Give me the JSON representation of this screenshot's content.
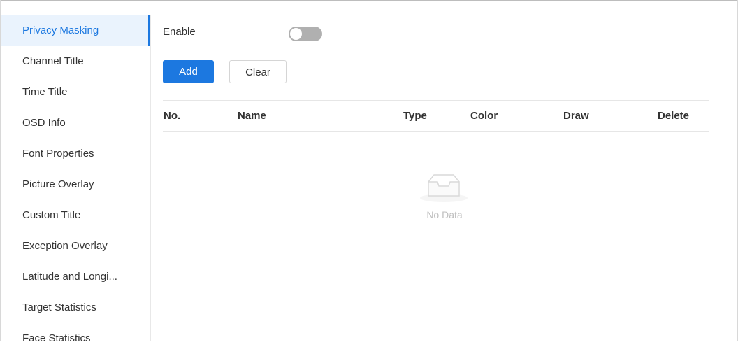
{
  "sidebar": {
    "items": [
      {
        "label": "Privacy Masking",
        "active": true
      },
      {
        "label": "Channel Title"
      },
      {
        "label": "Time Title"
      },
      {
        "label": "OSD Info"
      },
      {
        "label": "Font Properties"
      },
      {
        "label": "Picture Overlay"
      },
      {
        "label": "Custom Title"
      },
      {
        "label": "Exception Overlay"
      },
      {
        "label": "Latitude and Longi..."
      },
      {
        "label": "Target Statistics"
      },
      {
        "label": "Face Statistics"
      }
    ]
  },
  "settings": {
    "enable_label": "Enable",
    "enable_state": "off"
  },
  "toolbar": {
    "add_label": "Add",
    "clear_label": "Clear"
  },
  "table": {
    "columns": [
      "No.",
      "Name",
      "Type",
      "Color",
      "Draw",
      "Delete"
    ],
    "rows": [],
    "empty_text": "No Data",
    "empty_icon": "inbox-icon"
  },
  "colors": {
    "accent": "#1c78e0",
    "active_bg": "#eaf3fd",
    "toggle_off": "#b0b0b0"
  }
}
